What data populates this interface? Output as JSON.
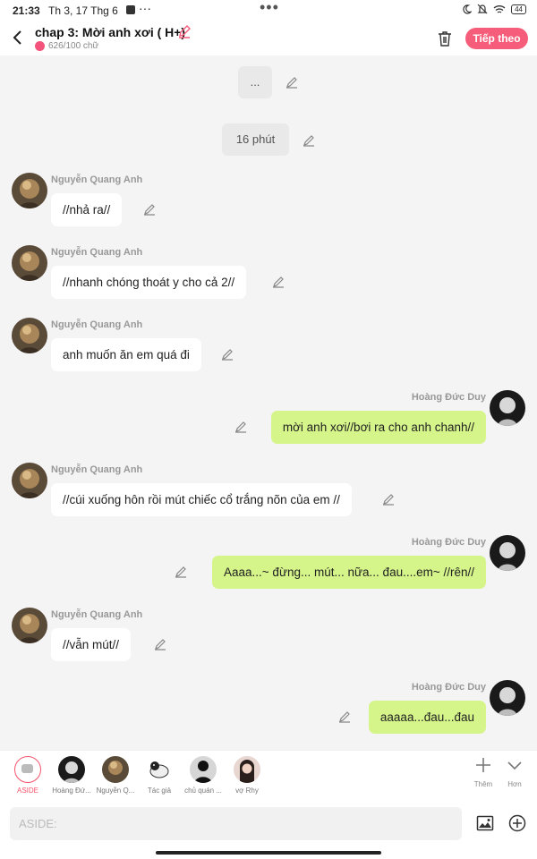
{
  "status": {
    "time": "21:33",
    "date": "Th 3, 17 Thg 6",
    "battery": "44"
  },
  "header": {
    "title": "chap 3: Mời anh xơi ( H+)",
    "subtitle": "626/100 chữ",
    "next_label": "Tiếp theo"
  },
  "chat": {
    "center_messages": [
      "...",
      "16 phút"
    ],
    "messages": [
      {
        "side": "left",
        "name": "Nguyễn Quang Anh",
        "text": "//nhả ra//"
      },
      {
        "side": "left",
        "name": "Nguyễn Quang Anh",
        "text": "//nhanh chóng thoát y cho cả 2//"
      },
      {
        "side": "left",
        "name": "Nguyễn Quang Anh",
        "text": "anh muốn ăn em quá đi"
      },
      {
        "side": "right",
        "name": "Hoàng Đức Duy",
        "text": "mời anh xơi//bơi ra cho anh chanh//"
      },
      {
        "side": "left",
        "name": "Nguyễn Quang Anh",
        "text": "//cúi xuống hôn rồi mút chiếc cổ trắng nõn của em //"
      },
      {
        "side": "right",
        "name": "Hoàng Đức Duy",
        "text": "Aaaa...~ đừng... mút... nữa... đau....em~ //rên//"
      },
      {
        "side": "left",
        "name": "Nguyễn Quang Anh",
        "text": "//vẫn mút//"
      },
      {
        "side": "right",
        "name": "Hoàng Đức Duy",
        "text": "aaaaa...đau...đau"
      }
    ]
  },
  "characters": [
    {
      "label": "ASIDE",
      "active": true
    },
    {
      "label": "Hoàng Đứ..."
    },
    {
      "label": "Nguyễn Q..."
    },
    {
      "label": "Tác giả"
    },
    {
      "label": "chủ quán ..."
    },
    {
      "label": "vợ Rhy"
    }
  ],
  "tools": {
    "more_label": "Thêm",
    "less_label": "Hơn"
  },
  "input": {
    "placeholder": "ASIDE:"
  },
  "colors": {
    "accent": "#f55d7a",
    "right_bubble": "#d5f58a",
    "left_bubble": "#ffffff",
    "background": "#f4f4f4"
  }
}
